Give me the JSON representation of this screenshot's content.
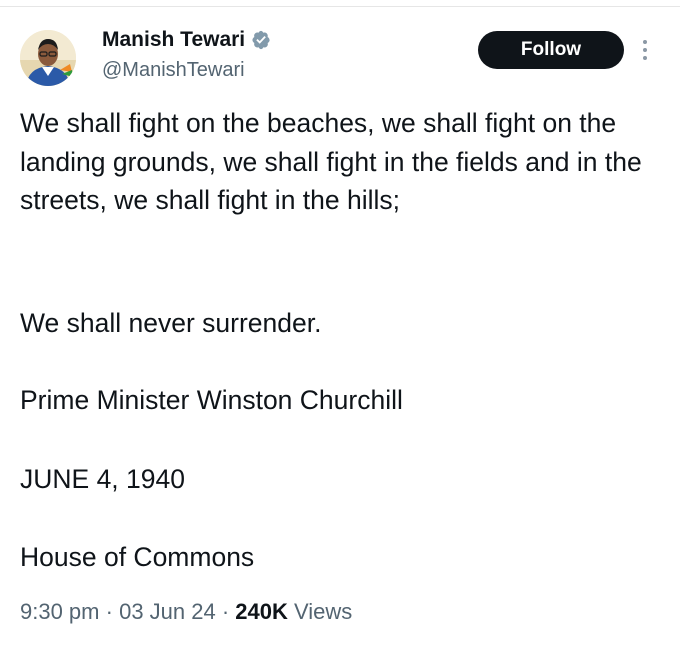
{
  "tweet": {
    "author": {
      "display_name": "Manish Tewari",
      "handle": "@ManishTewari"
    },
    "follow_label": "Follow",
    "paragraphs": [
      "We shall fight on the beaches, we shall fight on the landing grounds, we shall fight in the fields and in the streets, we shall fight in the hills;",
      "We shall never surrender.",
      "Prime Minister Winston Churchill",
      "JUNE 4, 1940",
      "House of Commons"
    ],
    "meta": {
      "time": "9:30 pm",
      "separator": "·",
      "date": "03 Jun 24",
      "views_count": "240K",
      "views_label": "Views"
    }
  },
  "colors": {
    "text": "#0f1419",
    "secondary": "#536471",
    "follow_bg": "#0f1419",
    "verified_badge": "#829aab"
  },
  "icons": {
    "avatar": "profile-photo",
    "verified": "verified-badge-icon",
    "more": "more-options-icon"
  }
}
